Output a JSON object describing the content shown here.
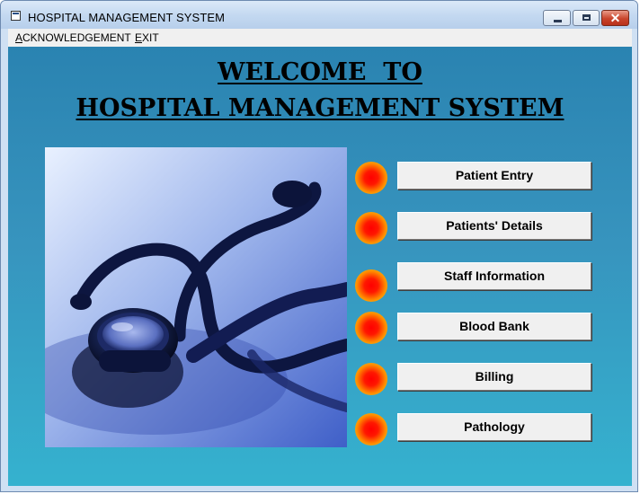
{
  "window": {
    "title": "HOSPITAL MANAGEMENT SYSTEM"
  },
  "menu": {
    "acknowledgement": {
      "mnemonic": "A",
      "rest": "CKNOWLEDGEMENT"
    },
    "exit": {
      "mnemonic": "E",
      "rest": "XIT"
    }
  },
  "heading": {
    "line1": "WELCOME  TO",
    "line2": "HOSPITAL MANAGEMENT SYSTEM"
  },
  "buttons": [
    {
      "label": "Patient Entry"
    },
    {
      "label": "Patients' Details"
    },
    {
      "label": "Staff Information"
    },
    {
      "label": "Blood Bank"
    },
    {
      "label": "Billing"
    },
    {
      "label": "Pathology"
    }
  ],
  "icons": {
    "app": "window-app-icon",
    "minimize": "minimize-icon",
    "maximize": "maximize-icon",
    "close": "close-icon",
    "bullet": "red-orb-icon",
    "photo": "stethoscope-image"
  },
  "colors": {
    "client_top": "#2a83b1",
    "client_bottom": "#35b2cf",
    "bullet_core": "#ff0000",
    "bullet_edge": "#ffe400"
  }
}
